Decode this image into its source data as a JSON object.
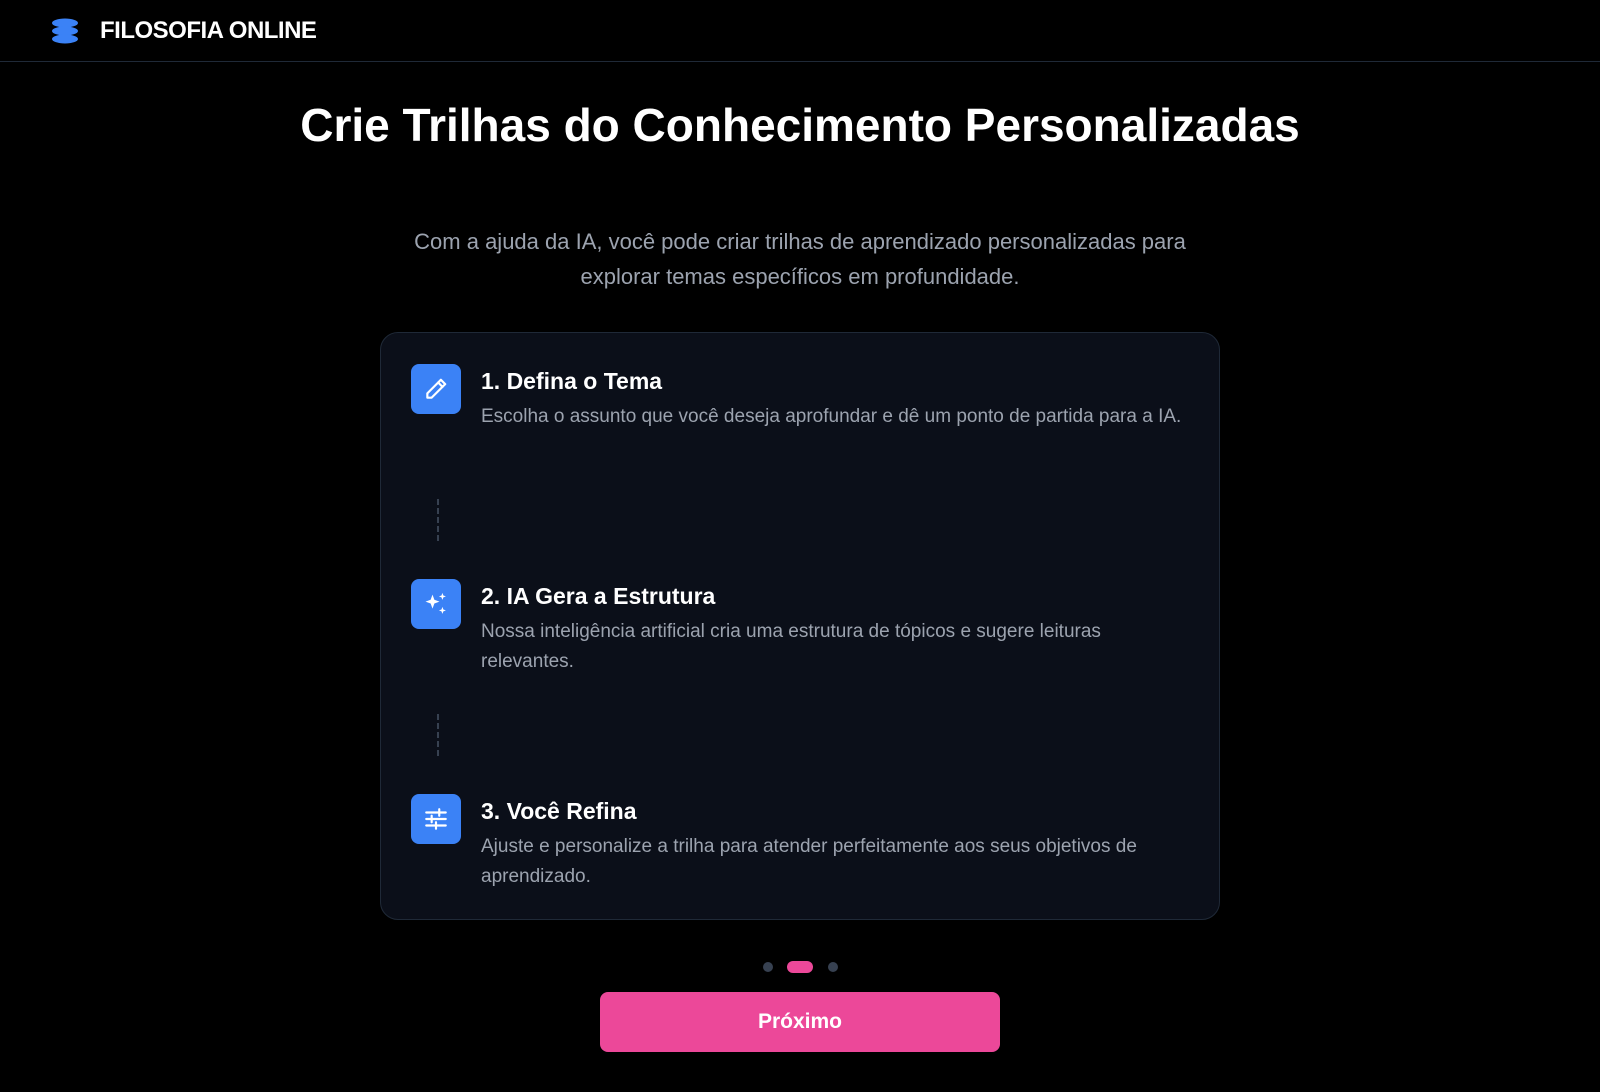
{
  "header": {
    "brand_name": "FILOSOFIA ONLINE",
    "logo_icon": "stack-icon",
    "accent_color": "#3b82f6"
  },
  "hero": {
    "title": "Crie Trilhas do Conhecimento Personalizadas",
    "subtitle": "Com a ajuda da IA, você pode criar trilhas de aprendizado personalizadas para explorar temas específicos em profundidade."
  },
  "steps": [
    {
      "icon": "pencil-icon",
      "title": "1. Defina o Tema",
      "description": "Escolha o assunto que você deseja aprofundar e dê um ponto de partida para a IA."
    },
    {
      "icon": "sparkles-icon",
      "title": "2. IA Gera a Estrutura",
      "description": "Nossa inteligência artificial cria uma estrutura de tópicos e sugere leituras relevantes."
    },
    {
      "icon": "sliders-icon",
      "title": "3. Você Refina",
      "description": "Ajuste e personalize a trilha para atender perfeitamente aos seus objetivos de aprendizado."
    }
  ],
  "pager": {
    "total": 3,
    "active_index": 1,
    "active_color": "#ec4899"
  },
  "actions": {
    "next_label": "Próximo",
    "next_color": "#ec4899"
  }
}
